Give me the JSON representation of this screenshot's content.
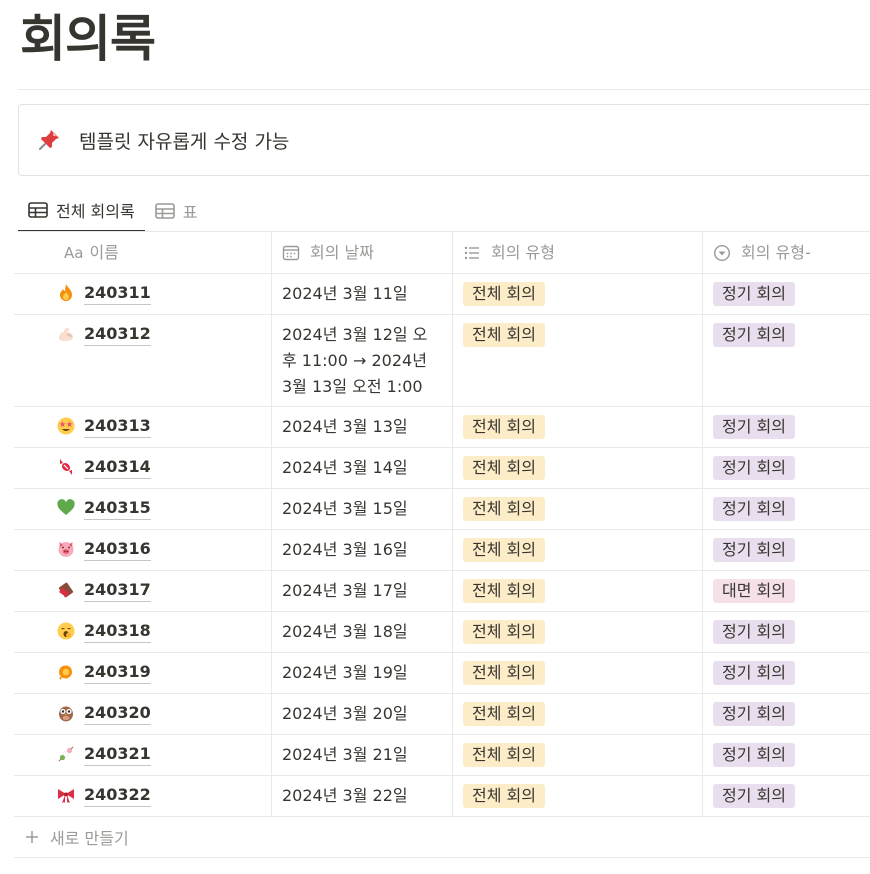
{
  "page": {
    "title": "회의록"
  },
  "callout": {
    "icon": "pushpin-icon",
    "text": "템플릿 자유롭게 수정 가능"
  },
  "views": [
    {
      "label": "전체 회의록",
      "icon": "table-icon",
      "active": true
    },
    {
      "label": "표",
      "icon": "table-icon",
      "active": false
    }
  ],
  "columns": {
    "name": {
      "label": "이름",
      "prefix": "Aa"
    },
    "date": {
      "label": "회의 날짜",
      "icon": "calendar-icon"
    },
    "type": {
      "label": "회의 유형",
      "icon": "list-icon"
    },
    "type2": {
      "label": "회의 유형-",
      "icon": "select-icon"
    }
  },
  "rows": [
    {
      "emoji": "fire-emoji",
      "name": "240311",
      "date": "2024년 3월 11일",
      "type": "전체 회의",
      "type2": "정기 회의",
      "type2_color": "purple"
    },
    {
      "emoji": "flexed-biceps-emoji",
      "name": "240312",
      "date": "2024년 3월 12일 오후 11:00 → 2024년 3월 13일 오전 1:00",
      "type": "전체 회의",
      "type2": "정기 회의",
      "type2_color": "purple"
    },
    {
      "emoji": "star-struck-emoji",
      "name": "240313",
      "date": "2024년 3월 13일",
      "type": "전체 회의",
      "type2": "정기 회의",
      "type2_color": "purple"
    },
    {
      "emoji": "candy-emoji",
      "name": "240314",
      "date": "2024년 3월 14일",
      "type": "전체 회의",
      "type2": "정기 회의",
      "type2_color": "purple"
    },
    {
      "emoji": "green-heart-emoji",
      "name": "240315",
      "date": "2024년 3월 15일",
      "type": "전체 회의",
      "type2": "정기 회의",
      "type2_color": "purple"
    },
    {
      "emoji": "pig-face-emoji",
      "name": "240316",
      "date": "2024년 3월 16일",
      "type": "전체 회의",
      "type2": "정기 회의",
      "type2_color": "purple"
    },
    {
      "emoji": "chocolate-bar-emoji",
      "name": "240317",
      "date": "2024년 3월 17일",
      "type": "전체 회의",
      "type2": "대면 회의",
      "type2_color": "pink"
    },
    {
      "emoji": "yawning-face-emoji",
      "name": "240318",
      "date": "2024년 3월 18일",
      "type": "전체 회의",
      "type2": "정기 회의",
      "type2_color": "purple"
    },
    {
      "emoji": "shrimp-emoji",
      "name": "240319",
      "date": "2024년 3월 19일",
      "type": "전체 회의",
      "type2": "정기 회의",
      "type2_color": "purple"
    },
    {
      "emoji": "owl-emoji",
      "name": "240320",
      "date": "2024년 3월 20일",
      "type": "전체 회의",
      "type2": "정기 회의",
      "type2_color": "purple"
    },
    {
      "emoji": "dango-emoji",
      "name": "240321",
      "date": "2024년 3월 21일",
      "type": "전체 회의",
      "type2": "정기 회의",
      "type2_color": "purple"
    },
    {
      "emoji": "ribbon-emoji",
      "name": "240322",
      "date": "2024년 3월 22일",
      "type": "전체 회의",
      "type2": "정기 회의",
      "type2_color": "purple"
    }
  ],
  "new_row": {
    "label": "새로 만들기",
    "icon": "plus-icon"
  },
  "colors": {
    "tag_yellow": "#fdecc8",
    "tag_purple": "#e8deee",
    "tag_pink": "#f5e0e9",
    "text": "#37352f",
    "muted": "#9b9a97",
    "border": "#e9e9e7"
  }
}
